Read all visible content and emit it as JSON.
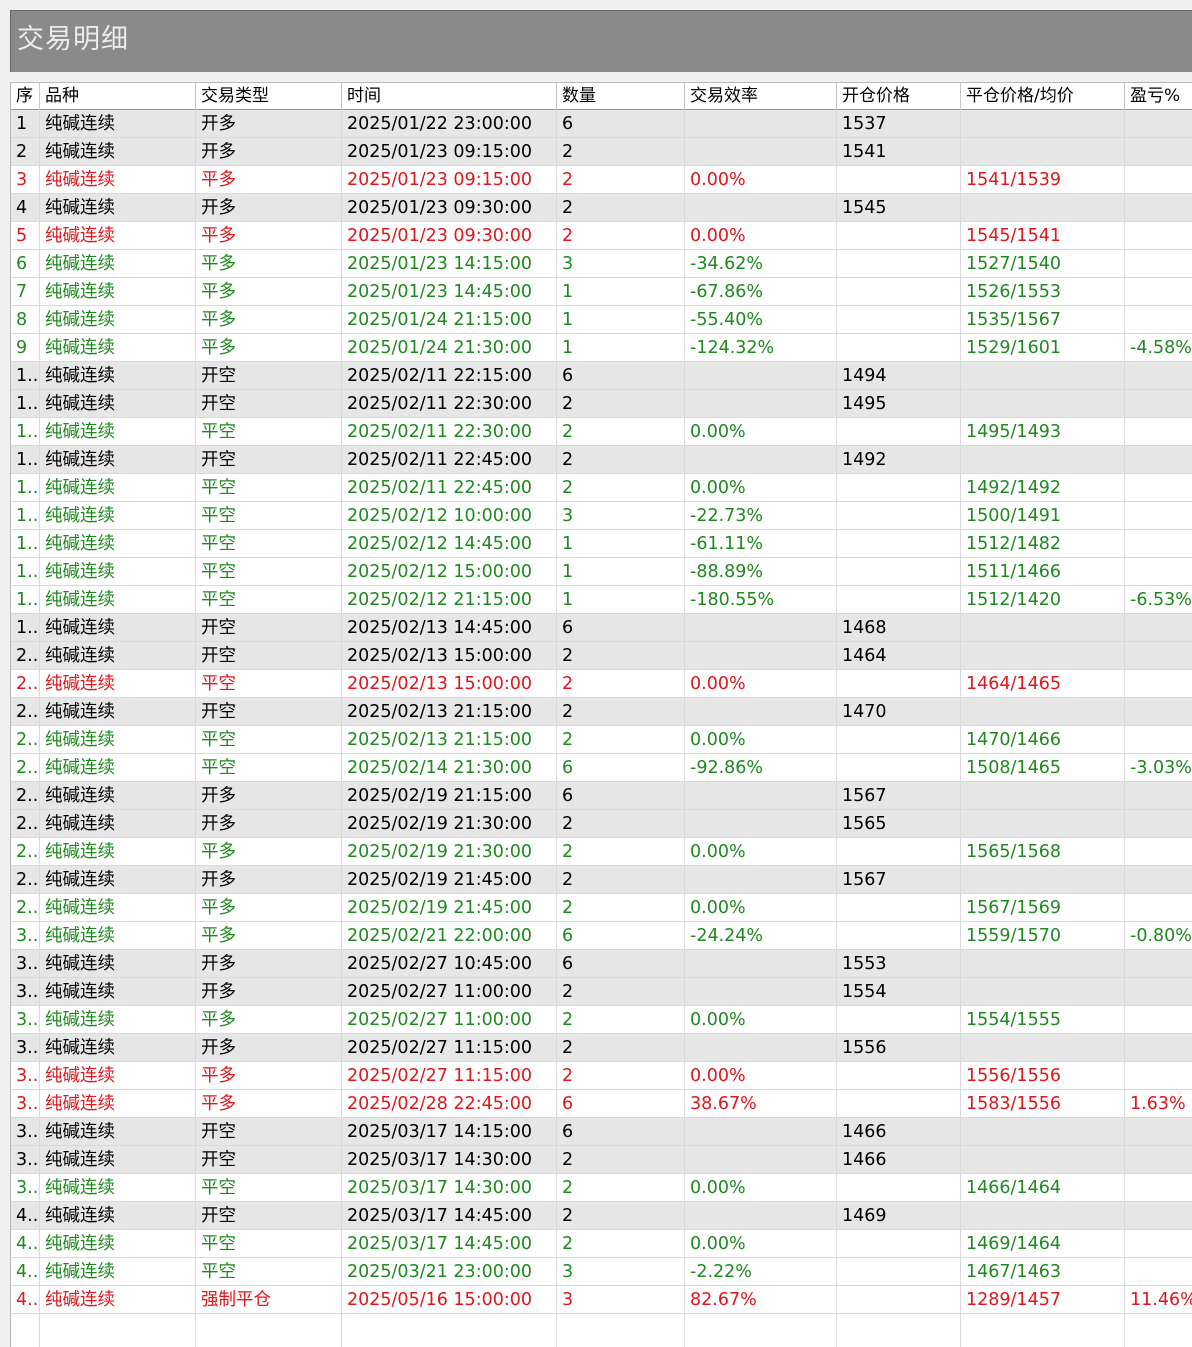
{
  "title": "交易明细",
  "colors": {
    "neutral": "#000000",
    "profit": "#e0161b",
    "loss": "#1e8a1e",
    "open_row_bg": "#e6e6e6",
    "title_bg": "#8a8a8a"
  },
  "columns": [
    "序",
    "品种",
    "交易类型",
    "时间",
    "数量",
    "交易效率",
    "开仓价格",
    "平仓价格/均价",
    "盈亏%"
  ],
  "rows": [
    {
      "idx": "1",
      "product": "纯碱连续",
      "type": "开多",
      "time": "2025/01/22 23:00:00",
      "qty": "6",
      "eff": "",
      "open": "1537",
      "close": "",
      "pnl": "",
      "kind": "open"
    },
    {
      "idx": "2",
      "product": "纯碱连续",
      "type": "开多",
      "time": "2025/01/23 09:15:00",
      "qty": "2",
      "eff": "",
      "open": "1541",
      "close": "",
      "pnl": "",
      "kind": "open"
    },
    {
      "idx": "3",
      "product": "纯碱连续",
      "type": "平多",
      "time": "2025/01/23 09:15:00",
      "qty": "2",
      "eff": "0.00%",
      "open": "",
      "close": "1541/1539",
      "pnl": "",
      "kind": "profit"
    },
    {
      "idx": "4",
      "product": "纯碱连续",
      "type": "开多",
      "time": "2025/01/23 09:30:00",
      "qty": "2",
      "eff": "",
      "open": "1545",
      "close": "",
      "pnl": "",
      "kind": "open"
    },
    {
      "idx": "5",
      "product": "纯碱连续",
      "type": "平多",
      "time": "2025/01/23 09:30:00",
      "qty": "2",
      "eff": "0.00%",
      "open": "",
      "close": "1545/1541",
      "pnl": "",
      "kind": "profit"
    },
    {
      "idx": "6",
      "product": "纯碱连续",
      "type": "平多",
      "time": "2025/01/23 14:15:00",
      "qty": "3",
      "eff": "-34.62%",
      "open": "",
      "close": "1527/1540",
      "pnl": "",
      "kind": "loss"
    },
    {
      "idx": "7",
      "product": "纯碱连续",
      "type": "平多",
      "time": "2025/01/23 14:45:00",
      "qty": "1",
      "eff": "-67.86%",
      "open": "",
      "close": "1526/1553",
      "pnl": "",
      "kind": "loss"
    },
    {
      "idx": "8",
      "product": "纯碱连续",
      "type": "平多",
      "time": "2025/01/24 21:15:00",
      "qty": "1",
      "eff": "-55.40%",
      "open": "",
      "close": "1535/1567",
      "pnl": "",
      "kind": "loss"
    },
    {
      "idx": "9",
      "product": "纯碱连续",
      "type": "平多",
      "time": "2025/01/24 21:30:00",
      "qty": "1",
      "eff": "-124.32%",
      "open": "",
      "close": "1529/1601",
      "pnl": "-4.58%",
      "kind": "loss"
    },
    {
      "idx": "1..",
      "product": "纯碱连续",
      "type": "开空",
      "time": "2025/02/11 22:15:00",
      "qty": "6",
      "eff": "",
      "open": "1494",
      "close": "",
      "pnl": "",
      "kind": "open"
    },
    {
      "idx": "1..",
      "product": "纯碱连续",
      "type": "开空",
      "time": "2025/02/11 22:30:00",
      "qty": "2",
      "eff": "",
      "open": "1495",
      "close": "",
      "pnl": "",
      "kind": "open"
    },
    {
      "idx": "1..",
      "product": "纯碱连续",
      "type": "平空",
      "time": "2025/02/11 22:30:00",
      "qty": "2",
      "eff": "0.00%",
      "open": "",
      "close": "1495/1493",
      "pnl": "",
      "kind": "loss"
    },
    {
      "idx": "1..",
      "product": "纯碱连续",
      "type": "开空",
      "time": "2025/02/11 22:45:00",
      "qty": "2",
      "eff": "",
      "open": "1492",
      "close": "",
      "pnl": "",
      "kind": "open"
    },
    {
      "idx": "1..",
      "product": "纯碱连续",
      "type": "平空",
      "time": "2025/02/11 22:45:00",
      "qty": "2",
      "eff": "0.00%",
      "open": "",
      "close": "1492/1492",
      "pnl": "",
      "kind": "loss"
    },
    {
      "idx": "1..",
      "product": "纯碱连续",
      "type": "平空",
      "time": "2025/02/12 10:00:00",
      "qty": "3",
      "eff": "-22.73%",
      "open": "",
      "close": "1500/1491",
      "pnl": "",
      "kind": "loss"
    },
    {
      "idx": "1..",
      "product": "纯碱连续",
      "type": "平空",
      "time": "2025/02/12 14:45:00",
      "qty": "1",
      "eff": "-61.11%",
      "open": "",
      "close": "1512/1482",
      "pnl": "",
      "kind": "loss"
    },
    {
      "idx": "1..",
      "product": "纯碱连续",
      "type": "平空",
      "time": "2025/02/12 15:00:00",
      "qty": "1",
      "eff": "-88.89%",
      "open": "",
      "close": "1511/1466",
      "pnl": "",
      "kind": "loss"
    },
    {
      "idx": "1..",
      "product": "纯碱连续",
      "type": "平空",
      "time": "2025/02/12 21:15:00",
      "qty": "1",
      "eff": "-180.55%",
      "open": "",
      "close": "1512/1420",
      "pnl": "-6.53%",
      "kind": "loss"
    },
    {
      "idx": "1..",
      "product": "纯碱连续",
      "type": "开空",
      "time": "2025/02/13 14:45:00",
      "qty": "6",
      "eff": "",
      "open": "1468",
      "close": "",
      "pnl": "",
      "kind": "open"
    },
    {
      "idx": "2..",
      "product": "纯碱连续",
      "type": "开空",
      "time": "2025/02/13 15:00:00",
      "qty": "2",
      "eff": "",
      "open": "1464",
      "close": "",
      "pnl": "",
      "kind": "open"
    },
    {
      "idx": "2..",
      "product": "纯碱连续",
      "type": "平空",
      "time": "2025/02/13 15:00:00",
      "qty": "2",
      "eff": "0.00%",
      "open": "",
      "close": "1464/1465",
      "pnl": "",
      "kind": "profit"
    },
    {
      "idx": "2..",
      "product": "纯碱连续",
      "type": "开空",
      "time": "2025/02/13 21:15:00",
      "qty": "2",
      "eff": "",
      "open": "1470",
      "close": "",
      "pnl": "",
      "kind": "open"
    },
    {
      "idx": "2..",
      "product": "纯碱连续",
      "type": "平空",
      "time": "2025/02/13 21:15:00",
      "qty": "2",
      "eff": "0.00%",
      "open": "",
      "close": "1470/1466",
      "pnl": "",
      "kind": "loss"
    },
    {
      "idx": "2..",
      "product": "纯碱连续",
      "type": "平空",
      "time": "2025/02/14 21:30:00",
      "qty": "6",
      "eff": "-92.86%",
      "open": "",
      "close": "1508/1465",
      "pnl": "-3.03%",
      "kind": "loss"
    },
    {
      "idx": "2..",
      "product": "纯碱连续",
      "type": "开多",
      "time": "2025/02/19 21:15:00",
      "qty": "6",
      "eff": "",
      "open": "1567",
      "close": "",
      "pnl": "",
      "kind": "open"
    },
    {
      "idx": "2..",
      "product": "纯碱连续",
      "type": "开多",
      "time": "2025/02/19 21:30:00",
      "qty": "2",
      "eff": "",
      "open": "1565",
      "close": "",
      "pnl": "",
      "kind": "open"
    },
    {
      "idx": "2..",
      "product": "纯碱连续",
      "type": "平多",
      "time": "2025/02/19 21:30:00",
      "qty": "2",
      "eff": "0.00%",
      "open": "",
      "close": "1565/1568",
      "pnl": "",
      "kind": "loss"
    },
    {
      "idx": "2..",
      "product": "纯碱连续",
      "type": "开多",
      "time": "2025/02/19 21:45:00",
      "qty": "2",
      "eff": "",
      "open": "1567",
      "close": "",
      "pnl": "",
      "kind": "open"
    },
    {
      "idx": "2..",
      "product": "纯碱连续",
      "type": "平多",
      "time": "2025/02/19 21:45:00",
      "qty": "2",
      "eff": "0.00%",
      "open": "",
      "close": "1567/1569",
      "pnl": "",
      "kind": "loss"
    },
    {
      "idx": "3..",
      "product": "纯碱连续",
      "type": "平多",
      "time": "2025/02/21 22:00:00",
      "qty": "6",
      "eff": "-24.24%",
      "open": "",
      "close": "1559/1570",
      "pnl": "-0.80%",
      "kind": "loss"
    },
    {
      "idx": "3..",
      "product": "纯碱连续",
      "type": "开多",
      "time": "2025/02/27 10:45:00",
      "qty": "6",
      "eff": "",
      "open": "1553",
      "close": "",
      "pnl": "",
      "kind": "open"
    },
    {
      "idx": "3..",
      "product": "纯碱连续",
      "type": "开多",
      "time": "2025/02/27 11:00:00",
      "qty": "2",
      "eff": "",
      "open": "1554",
      "close": "",
      "pnl": "",
      "kind": "open"
    },
    {
      "idx": "3..",
      "product": "纯碱连续",
      "type": "平多",
      "time": "2025/02/27 11:00:00",
      "qty": "2",
      "eff": "0.00%",
      "open": "",
      "close": "1554/1555",
      "pnl": "",
      "kind": "loss"
    },
    {
      "idx": "3..",
      "product": "纯碱连续",
      "type": "开多",
      "time": "2025/02/27 11:15:00",
      "qty": "2",
      "eff": "",
      "open": "1556",
      "close": "",
      "pnl": "",
      "kind": "open"
    },
    {
      "idx": "3..",
      "product": "纯碱连续",
      "type": "平多",
      "time": "2025/02/27 11:15:00",
      "qty": "2",
      "eff": "0.00%",
      "open": "",
      "close": "1556/1556",
      "pnl": "",
      "kind": "profit"
    },
    {
      "idx": "3..",
      "product": "纯碱连续",
      "type": "平多",
      "time": "2025/02/28 22:45:00",
      "qty": "6",
      "eff": "38.67%",
      "open": "",
      "close": "1583/1556",
      "pnl": "1.63%",
      "kind": "profit"
    },
    {
      "idx": "3..",
      "product": "纯碱连续",
      "type": "开空",
      "time": "2025/03/17 14:15:00",
      "qty": "6",
      "eff": "",
      "open": "1466",
      "close": "",
      "pnl": "",
      "kind": "open"
    },
    {
      "idx": "3..",
      "product": "纯碱连续",
      "type": "开空",
      "time": "2025/03/17 14:30:00",
      "qty": "2",
      "eff": "",
      "open": "1466",
      "close": "",
      "pnl": "",
      "kind": "open"
    },
    {
      "idx": "3..",
      "product": "纯碱连续",
      "type": "平空",
      "time": "2025/03/17 14:30:00",
      "qty": "2",
      "eff": "0.00%",
      "open": "",
      "close": "1466/1464",
      "pnl": "",
      "kind": "loss"
    },
    {
      "idx": "4..",
      "product": "纯碱连续",
      "type": "开空",
      "time": "2025/03/17 14:45:00",
      "qty": "2",
      "eff": "",
      "open": "1469",
      "close": "",
      "pnl": "",
      "kind": "open"
    },
    {
      "idx": "4..",
      "product": "纯碱连续",
      "type": "平空",
      "time": "2025/03/17 14:45:00",
      "qty": "2",
      "eff": "0.00%",
      "open": "",
      "close": "1469/1464",
      "pnl": "",
      "kind": "loss"
    },
    {
      "idx": "4..",
      "product": "纯碱连续",
      "type": "平空",
      "time": "2025/03/21 23:00:00",
      "qty": "3",
      "eff": "-2.22%",
      "open": "",
      "close": "1467/1463",
      "pnl": "",
      "kind": "loss"
    },
    {
      "idx": "4..",
      "product": "纯碱连续",
      "type": "强制平仓",
      "time": "2025/05/16 15:00:00",
      "qty": "3",
      "eff": "82.67%",
      "open": "",
      "close": "1289/1457",
      "pnl": "11.46%",
      "kind": "profit"
    }
  ]
}
